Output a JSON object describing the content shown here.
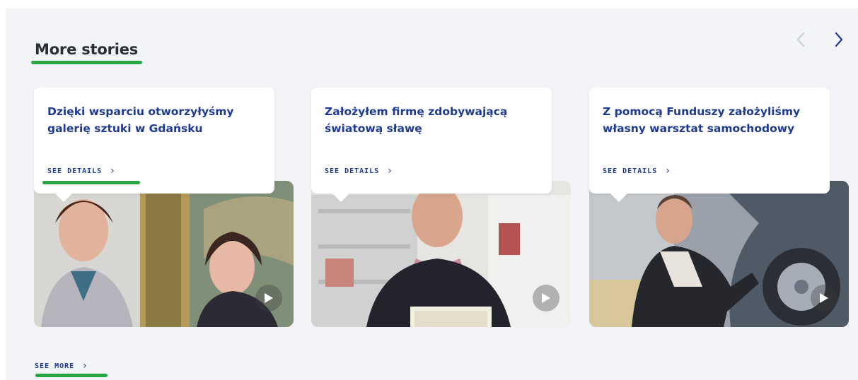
{
  "section": {
    "title": "More stories",
    "prev_icon": "chevron-left-icon",
    "next_icon": "chevron-right-icon",
    "see_more_label": "SEE MORE",
    "highlight_color": "#26a743",
    "link_color": "#1f3a93"
  },
  "cards": [
    {
      "title": "Dzięki wsparciu otworzyłyśmy galerię sztuki w Gdańsku",
      "details_label": "SEE DETAILS",
      "play_icon": "play-icon"
    },
    {
      "title": "Założyłem firmę zdobywającą światową sławę",
      "details_label": "SEE DETAILS",
      "play_icon": "play-icon"
    },
    {
      "title": "Z pomocą Funduszy założyliśmy własny warsztat samochodowy",
      "details_label": "SEE DETAILS",
      "play_icon": "play-icon"
    }
  ]
}
